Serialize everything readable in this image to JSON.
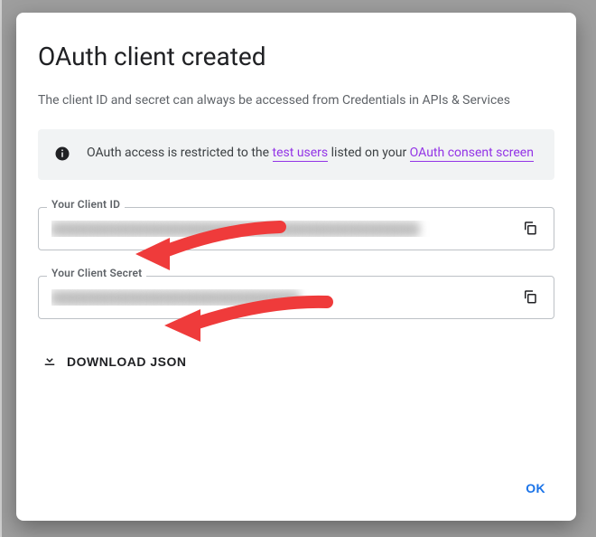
{
  "dialog": {
    "title": "OAuth client created",
    "subtitle": "The client ID and secret can always be accessed from Credentials in APIs & Services",
    "info": {
      "prefix": "OAuth access is restricted to the ",
      "link_users": "test users",
      "mid": " listed on your ",
      "link_consent": "OAuth consent screen"
    },
    "client_id": {
      "label": "Your Client ID",
      "value": "████████████████████████████████████████████████████"
    },
    "client_secret": {
      "label": "Your Client Secret",
      "value": "███████████████████████████████████"
    },
    "download_label": "DOWNLOAD JSON",
    "ok_label": "OK"
  },
  "icons": {
    "info": "info-icon",
    "copy": "copy-icon",
    "download": "download-icon"
  }
}
